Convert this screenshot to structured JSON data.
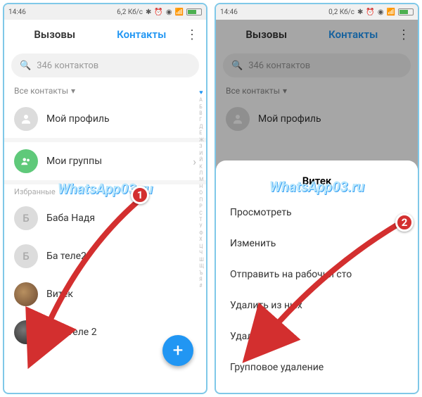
{
  "status": {
    "time": "14:46",
    "net_left": "6,2 Кб/с",
    "net_right": "0,2 Кб/с"
  },
  "tabs": {
    "calls": "Вызовы",
    "contacts": "Контакты"
  },
  "search": {
    "placeholder": "346 контактов"
  },
  "filter": {
    "label": "Все контакты"
  },
  "profile": {
    "label": "Мой профиль"
  },
  "groups": {
    "label": "Мои группы"
  },
  "fav_label": "Избранные",
  "contacts": {
    "baba": "Баба Надя",
    "tele2": "Ба           теле2",
    "vitek": "Витек",
    "ded": "Дед Теле 2"
  },
  "index_letters": [
    "А",
    "Б",
    "В",
    "Г",
    "Д",
    "Е",
    "Ж",
    "З",
    "И",
    "Й",
    "К",
    "Л",
    "М",
    "Н",
    "О",
    "П",
    "Р",
    "С",
    "Т",
    "У",
    "Ф",
    "Х",
    "Ц",
    "Ч",
    "Ш",
    "Щ",
    "Ъ",
    "Я",
    "#"
  ],
  "watermark": "WhatsApp03.ru",
  "sheet": {
    "title": "Витек",
    "view": "Просмотреть",
    "edit": "Изменить",
    "send": "Отправить на рабочий сто",
    "remove_fav": "Удалить из                ных",
    "delete": "Удалить",
    "group_delete": "Групповое удаление"
  },
  "markers": {
    "m1": "1",
    "m2": "2"
  }
}
